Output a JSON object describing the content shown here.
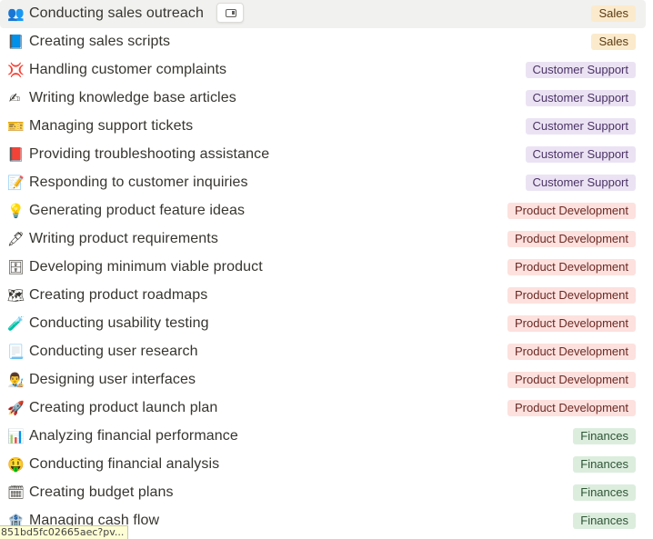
{
  "rows": [
    {
      "emoji": "👥",
      "icon": "people-icon",
      "title": "Conducting sales outreach",
      "tag": "Sales",
      "tag_class": "sales"
    },
    {
      "emoji": "📘",
      "icon": "blue-book-icon",
      "title": "Creating sales scripts",
      "tag": "Sales",
      "tag_class": "sales"
    },
    {
      "emoji": "💢",
      "icon": "anger-icon",
      "title": "Handling customer complaints",
      "tag": "Customer Support",
      "tag_class": "support"
    },
    {
      "emoji": "✍",
      "icon": "writing-hand-icon",
      "title": "Writing knowledge base articles",
      "tag": "Customer Support",
      "tag_class": "support"
    },
    {
      "emoji": "🎫",
      "icon": "ticket-icon",
      "title": "Managing support tickets",
      "tag": "Customer Support",
      "tag_class": "support"
    },
    {
      "emoji": "📕",
      "icon": "red-book-icon",
      "title": "Providing troubleshooting assistance",
      "tag": "Customer Support",
      "tag_class": "support"
    },
    {
      "emoji": "📝",
      "icon": "memo-icon",
      "title": "Responding to customer inquiries",
      "tag": "Customer Support",
      "tag_class": "support"
    },
    {
      "emoji": "💡",
      "icon": "light-bulb-icon",
      "title": "Generating product feature ideas",
      "tag": "Product Development",
      "tag_class": "product"
    },
    {
      "emoji": "🖋",
      "icon": "fountain-pen-icon",
      "title": "Writing product requirements",
      "tag": "Product Development",
      "tag_class": "product"
    },
    {
      "emoji": "🗄",
      "icon": "file-cabinet-icon",
      "title": "Developing minimum viable product",
      "tag": "Product Development",
      "tag_class": "product"
    },
    {
      "emoji": "🗺",
      "icon": "map-icon",
      "title": "Creating product roadmaps",
      "tag": "Product Development",
      "tag_class": "product"
    },
    {
      "emoji": "🧪",
      "icon": "test-tube-icon",
      "title": "Conducting usability testing",
      "tag": "Product Development",
      "tag_class": "product"
    },
    {
      "emoji": "📃",
      "icon": "page-icon",
      "title": "Conducting user research",
      "tag": "Product Development",
      "tag_class": "product"
    },
    {
      "emoji": "👨‍🎨",
      "icon": "artist-icon",
      "title": "Designing user interfaces",
      "tag": "Product Development",
      "tag_class": "product"
    },
    {
      "emoji": "🚀",
      "icon": "rocket-icon",
      "title": "Creating product launch plan",
      "tag": "Product Development",
      "tag_class": "product"
    },
    {
      "emoji": "📊",
      "icon": "bar-chart-icon",
      "title": "Analyzing financial performance",
      "tag": "Finances",
      "tag_class": "finance"
    },
    {
      "emoji": "🤑",
      "icon": "money-face-icon",
      "title": "Conducting financial analysis",
      "tag": "Finances",
      "tag_class": "finance"
    },
    {
      "emoji": "🗓",
      "icon": "calendar-icon",
      "title": "Creating budget plans",
      "tag": "Finances",
      "tag_class": "finance"
    },
    {
      "emoji": "🏦",
      "icon": "bank-icon",
      "title": "Managing cash flow",
      "tag": "Finances",
      "tag_class": "finance"
    }
  ],
  "hovered_row": 0,
  "peek_button": {
    "icon": "open-side-peek-icon"
  },
  "status_bar": {
    "url": "851bd5fc02665aec?pv..."
  },
  "colors": {
    "sales": "#fbeacc",
    "customer_support": "#ebe3f3",
    "product_development": "#fde1de",
    "finances": "#dcedde",
    "hover": "#f1f1ef"
  }
}
